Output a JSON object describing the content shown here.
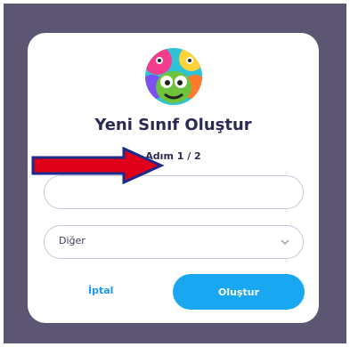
{
  "modal": {
    "title": "Yeni Sınıf Oluştur",
    "step": "Adım 1 / 2",
    "class_name": {
      "value": "",
      "placeholder": ""
    },
    "category": {
      "selected": "Diğer"
    },
    "cancel_label": "İptal",
    "create_label": "Oluştur"
  },
  "colors": {
    "backdrop": "#5c5673",
    "primary": "#1aa7f2",
    "title": "#2c2a50",
    "annotation_arrow": "#e0001a"
  },
  "icons": [
    "class-avatar-icon",
    "chevron-down-icon",
    "annotation-arrow-icon"
  ]
}
